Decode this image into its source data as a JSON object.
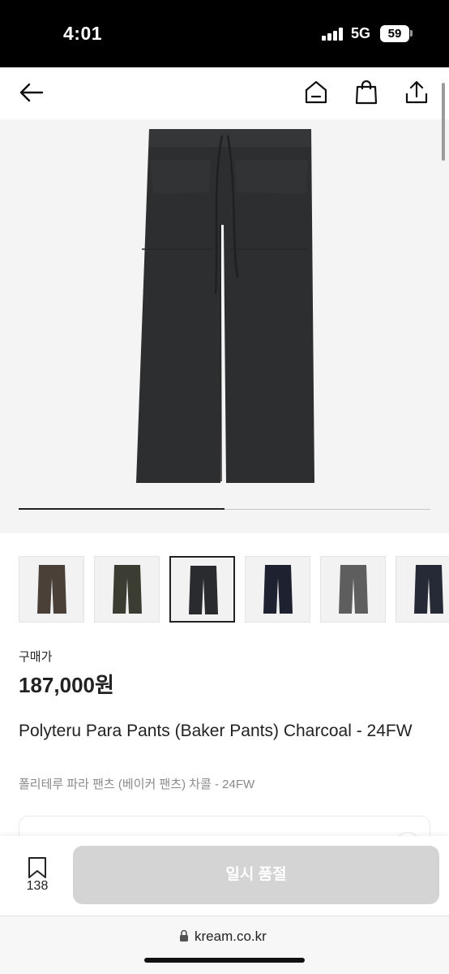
{
  "status_bar": {
    "time": "4:01",
    "network": "5G",
    "battery": "59"
  },
  "nav": {
    "back_icon": "arrow-left-icon",
    "home_icon": "home-icon",
    "bag_icon": "shopping-bag-icon",
    "share_icon": "share-icon"
  },
  "gallery": {
    "progress_fraction": 0.5,
    "selected_index": 2
  },
  "thumbnails": [
    {
      "color_name": "brown",
      "color": "#4a4038"
    },
    {
      "color_name": "olive",
      "color": "#3b3d33"
    },
    {
      "color_name": "charcoal",
      "color": "#2a2b2e"
    },
    {
      "color_name": "navy",
      "color": "#1e2230"
    },
    {
      "color_name": "grey",
      "color": "#5e5e5e"
    },
    {
      "color_name": "dark-navy",
      "color": "#262a36"
    }
  ],
  "product": {
    "price_label": "구매가",
    "price": "187,000원",
    "name": "Polyteru Para Pants (Baker Pants) Charcoal - 24FW",
    "name_ko": "폴리테루 파라 팬츠 (베이커 팬츠) 차콜 - 24FW"
  },
  "bottom": {
    "bookmark_count": "138",
    "action_label": "일시 품절"
  },
  "browser": {
    "url": "kream.co.kr"
  },
  "colors": {
    "accent": "#222222",
    "disabled": "#d4d4d4",
    "hero_bg": "#f4f4f4"
  }
}
